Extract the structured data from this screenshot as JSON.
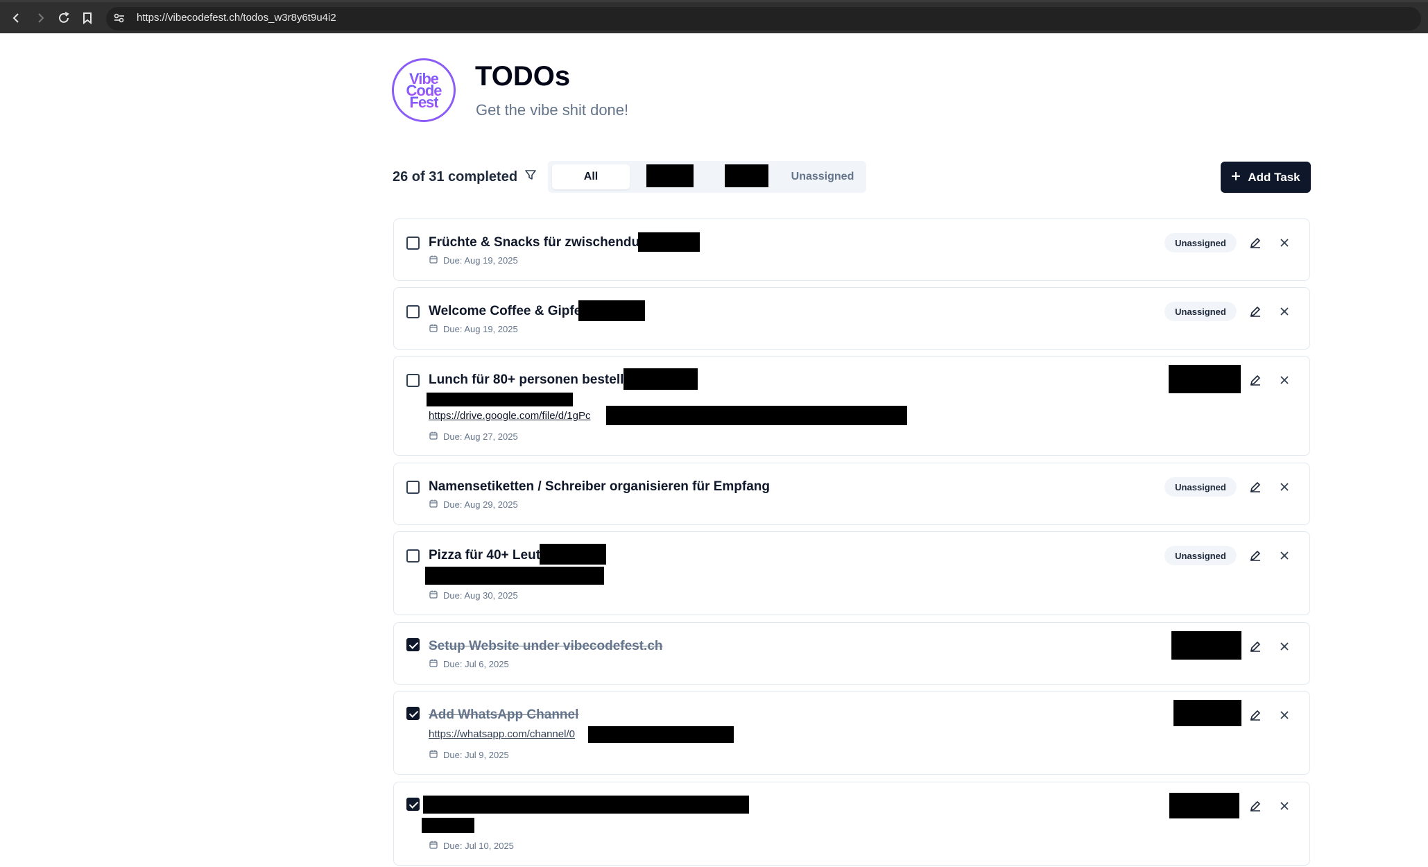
{
  "browser": {
    "url": "https://vibecodefest.ch/todos_w3r8y6t9u4i2"
  },
  "header": {
    "logo_lines": [
      "Vibe",
      "Code",
      "Fest"
    ],
    "title": "TODOs",
    "subtitle": "Get the vibe shit done!"
  },
  "toolbar": {
    "completed_text": "26 of 31 completed",
    "tabs": [
      {
        "label": "All",
        "active": true
      },
      {
        "label": "",
        "redacted": true
      },
      {
        "label": "",
        "redacted": true
      },
      {
        "label": "Unassigned",
        "active": false
      }
    ],
    "add_label": "Add Task"
  },
  "tasks": [
    {
      "title": "Früchte & Snacks für zwischendurch",
      "due": "Due: Aug 19, 2025",
      "assignee": "Unassigned",
      "done": false
    },
    {
      "title": "Welcome Coffee & Gipfeli",
      "due": "Due: Aug 19, 2025",
      "assignee": "Unassigned",
      "done": false
    },
    {
      "title": "Lunch für 80+ personen bestellen",
      "link": "https://drive.google.com/file/d/1gPc",
      "due": "Due: Aug 27, 2025",
      "assignee": "",
      "done": false
    },
    {
      "title": "Namensetiketten / Schreiber organisieren für Empfang",
      "due": "Due: Aug 29, 2025",
      "assignee": "Unassigned",
      "done": false
    },
    {
      "title": "Pizza für 40+ Leute",
      "due": "Due: Aug 30, 2025",
      "assignee": "Unassigned",
      "done": false
    },
    {
      "title": "Setup Website under vibecodefest.ch",
      "due": "Due: Jul 6, 2025",
      "assignee": "",
      "done": true
    },
    {
      "title": "Add WhatsApp Channel",
      "link": "https://whatsapp.com/channel/0",
      "due": "Due: Jul 9, 2025",
      "assignee": "",
      "done": true
    },
    {
      "title": "",
      "due": "Due: Jul 10, 2025",
      "assignee": "",
      "done": true
    }
  ],
  "icons": {
    "back": "back-arrow-icon",
    "forward": "forward-arrow-icon",
    "reload": "reload-icon",
    "bookmark": "bookmark-icon",
    "site_settings": "site-settings-icon",
    "filter": "filter-icon",
    "plus": "plus-icon",
    "calendar": "calendar-icon",
    "edit": "pencil-icon",
    "delete": "close-icon"
  },
  "colors": {
    "primary": "#0f172a",
    "muted": "#64748b",
    "badge_bg": "#f1f5f9",
    "logo_gradient_start": "#6d5dfc",
    "logo_gradient_end": "#a855f7"
  }
}
